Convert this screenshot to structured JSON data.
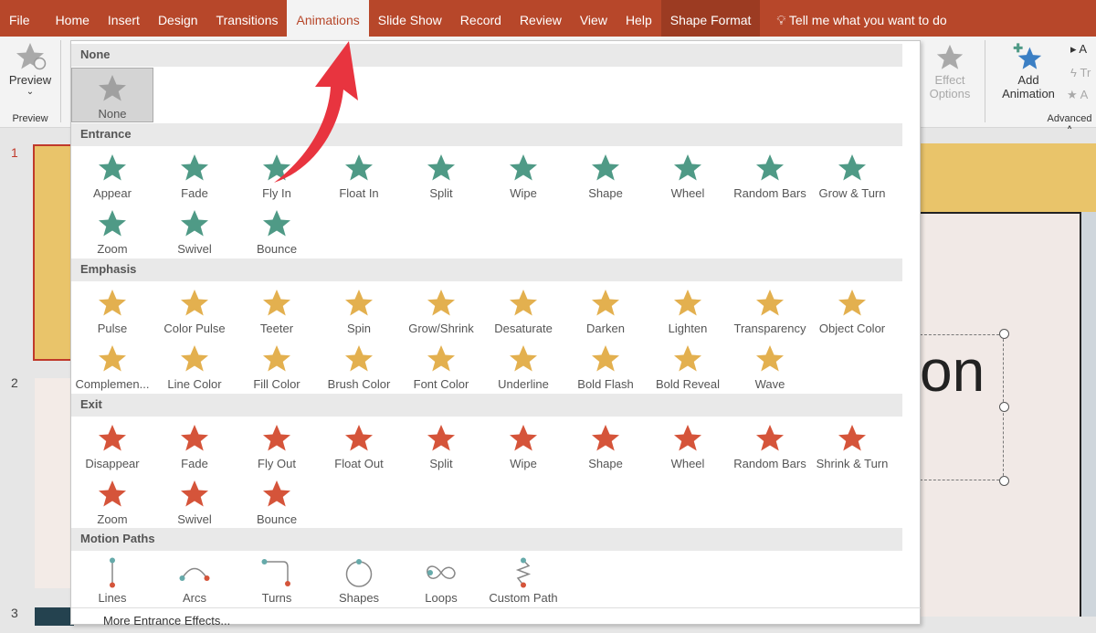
{
  "tabs": [
    "File",
    "Home",
    "Insert",
    "Design",
    "Transitions",
    "Animations",
    "Slide Show",
    "Record",
    "Review",
    "View",
    "Help",
    "Shape Format"
  ],
  "active_tab": "Animations",
  "tell_me": "Tell me what you want to do",
  "ribbon": {
    "preview": "Preview",
    "preview_group": "Preview",
    "effect": "Effect",
    "options": "Options",
    "add": "Add",
    "animation": "Animation",
    "advanced_group": "Advanced A",
    "adv1": "A",
    "adv2": "Tr",
    "adv3": "A"
  },
  "slide_numbers": [
    "1",
    "2",
    "3"
  ],
  "slide_text": "on",
  "colors": {
    "entrance": "#4f9a86",
    "emphasis": "#e3b04f",
    "exit": "#d5543a",
    "none": "#a0a0a0",
    "accent": "#b7472a"
  },
  "sections": [
    {
      "key": "none",
      "title": "None",
      "items": [
        "None"
      ]
    },
    {
      "key": "entrance",
      "title": "Entrance",
      "items": [
        "Appear",
        "Fade",
        "Fly In",
        "Float In",
        "Split",
        "Wipe",
        "Shape",
        "Wheel",
        "Random Bars",
        "Grow & Turn",
        "Zoom",
        "Swivel",
        "Bounce"
      ]
    },
    {
      "key": "emphasis",
      "title": "Emphasis",
      "items": [
        "Pulse",
        "Color Pulse",
        "Teeter",
        "Spin",
        "Grow/Shrink",
        "Desaturate",
        "Darken",
        "Lighten",
        "Transparency",
        "Object Color",
        "Complemen...",
        "Line Color",
        "Fill Color",
        "Brush Color",
        "Font Color",
        "Underline",
        "Bold Flash",
        "Bold Reveal",
        "Wave"
      ]
    },
    {
      "key": "exit",
      "title": "Exit",
      "items": [
        "Disappear",
        "Fade",
        "Fly Out",
        "Float Out",
        "Split",
        "Wipe",
        "Shape",
        "Wheel",
        "Random Bars",
        "Shrink & Turn",
        "Zoom",
        "Swivel",
        "Bounce"
      ]
    },
    {
      "key": "motion",
      "title": "Motion Paths",
      "items": [
        "Lines",
        "Arcs",
        "Turns",
        "Shapes",
        "Loops",
        "Custom Path"
      ]
    }
  ],
  "more": "More Entrance Effects..."
}
